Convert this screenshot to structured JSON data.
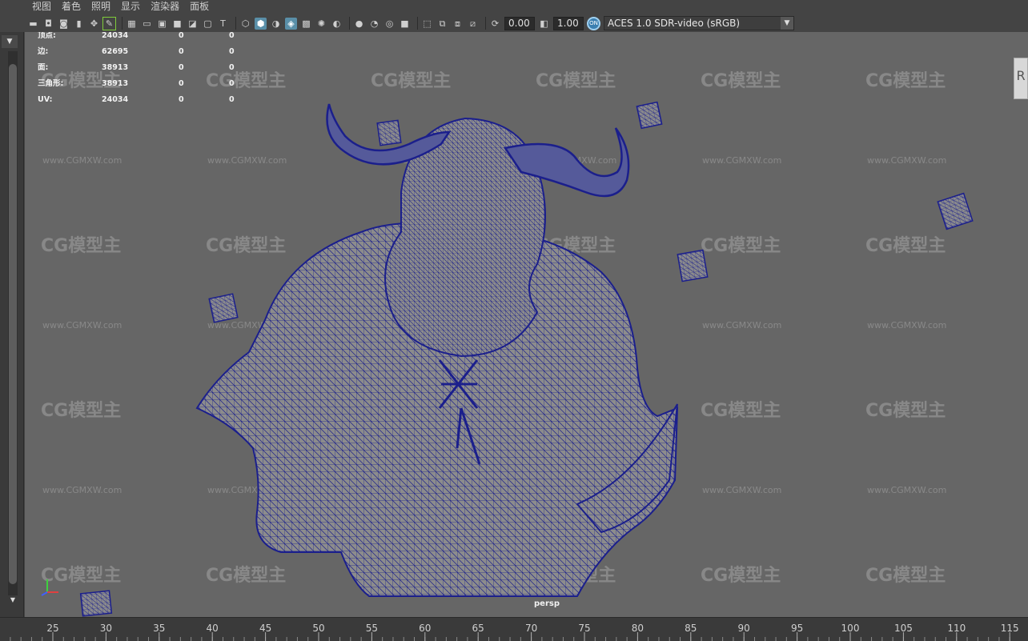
{
  "menu": {
    "items": [
      "视图",
      "着色",
      "照明",
      "显示",
      "渲染器",
      "面板"
    ]
  },
  "toolbar": {
    "exposure_value": "0.00",
    "gamma_value": "1.00",
    "color_space": "ACES 1.0 SDR-video (sRGB)",
    "aces_badge": "ON"
  },
  "hud": {
    "rows": [
      {
        "label": "顶点:",
        "v1": "24034",
        "v2": "0",
        "v3": "0"
      },
      {
        "label": "边:",
        "v1": "62695",
        "v2": "0",
        "v3": "0"
      },
      {
        "label": "面:",
        "v1": "38913",
        "v2": "0",
        "v3": "0"
      },
      {
        "label": "三角形:",
        "v1": "38913",
        "v2": "0",
        "v3": "0"
      },
      {
        "label": "UV:",
        "v1": "24034",
        "v2": "0",
        "v3": "0"
      }
    ]
  },
  "viewport": {
    "camera_name": "persp",
    "background_color": "#666666",
    "wire_color": "#1b1f8c",
    "right_tab_glyph": "R"
  },
  "watermark": {
    "logo_text": "CG模型主",
    "url_text": "www.CGMXW.com"
  },
  "timeline": {
    "ticks": [
      "25",
      "30",
      "35",
      "40",
      "45",
      "50",
      "55",
      "60",
      "65",
      "70",
      "75",
      "80",
      "85",
      "90",
      "95",
      "100",
      "105",
      "110",
      "115"
    ]
  }
}
